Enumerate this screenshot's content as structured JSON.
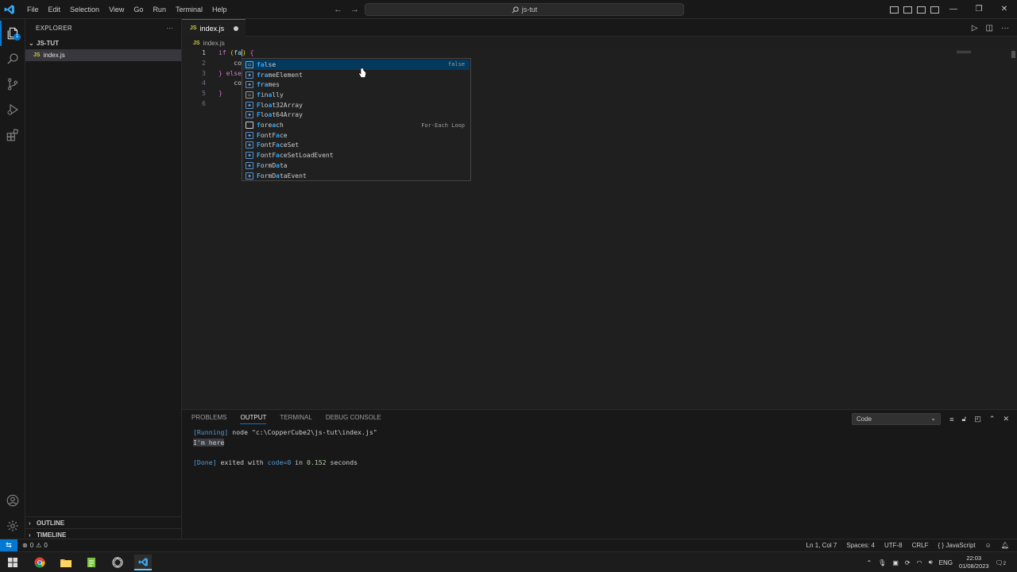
{
  "titlebar": {
    "menu": [
      "File",
      "Edit",
      "Selection",
      "View",
      "Go",
      "Run",
      "Terminal",
      "Help"
    ],
    "search_text": "js-tut"
  },
  "sidebar": {
    "title": "EXPLORER",
    "folder": "JS-TUT",
    "files": [
      "index.js"
    ],
    "outline": "OUTLINE",
    "timeline": "TIMELINE"
  },
  "editor": {
    "tab_label": "index.js",
    "file_icon_tag": "JS",
    "breadcrumb": "index.js",
    "line_numbers": [
      "1",
      "2",
      "3",
      "4",
      "5",
      "6"
    ],
    "lines": {
      "l1_kw": "if",
      "l1_open": "(",
      "l1_typed": "fa",
      "l1_close": ")",
      "l1_brace": "{",
      "l2": "co",
      "l3_close": "}",
      "l3_kw": "else",
      "l4": "co",
      "l5": "}"
    }
  },
  "suggest": {
    "items": [
      {
        "label": "false",
        "detail": "false",
        "icon": "keyword"
      },
      {
        "label": "frameElement",
        "detail": "",
        "icon": "variable"
      },
      {
        "label": "frames",
        "detail": "",
        "icon": "variable"
      },
      {
        "label": "finally",
        "detail": "",
        "icon": "keyword"
      },
      {
        "label": "Float32Array",
        "detail": "",
        "icon": "variable"
      },
      {
        "label": "Float64Array",
        "detail": "",
        "icon": "variable"
      },
      {
        "label": "foreach",
        "detail": "For-Each Loop",
        "icon": "snippet"
      },
      {
        "label": "FontFace",
        "detail": "",
        "icon": "variable"
      },
      {
        "label": "FontFaceSet",
        "detail": "",
        "icon": "variable"
      },
      {
        "label": "FontFaceSetLoadEvent",
        "detail": "",
        "icon": "variable"
      },
      {
        "label": "FormData",
        "detail": "",
        "icon": "variable"
      },
      {
        "label": "FormDataEvent",
        "detail": "",
        "icon": "variable"
      }
    ]
  },
  "panel": {
    "tabs": [
      "PROBLEMS",
      "OUTPUT",
      "TERMINAL",
      "DEBUG CONSOLE"
    ],
    "active_tab": "OUTPUT",
    "channel": "Code",
    "output": {
      "running_tag": "[Running]",
      "running_cmd": " node \"c:\\CopperCube2\\js-tut\\index.js\"",
      "log": "I'm here",
      "done_tag": "[Done]",
      "done_pre": " exited with ",
      "done_code": "code=0",
      "done_mid": " in ",
      "done_secs": "0.152",
      "done_post": " seconds"
    }
  },
  "statusbar": {
    "errors": "0",
    "warnings": "0",
    "position": "Ln 1, Col 7",
    "spaces": "Spaces: 4",
    "encoding": "UTF-8",
    "eol": "CRLF",
    "language": "JavaScript"
  },
  "taskbar": {
    "lang": "ENG",
    "time": "22:03",
    "date": "01/08/2023",
    "notifications": "2"
  },
  "colors": {
    "accent": "#0078d4",
    "suggest_highlight": "#2aaaff"
  }
}
